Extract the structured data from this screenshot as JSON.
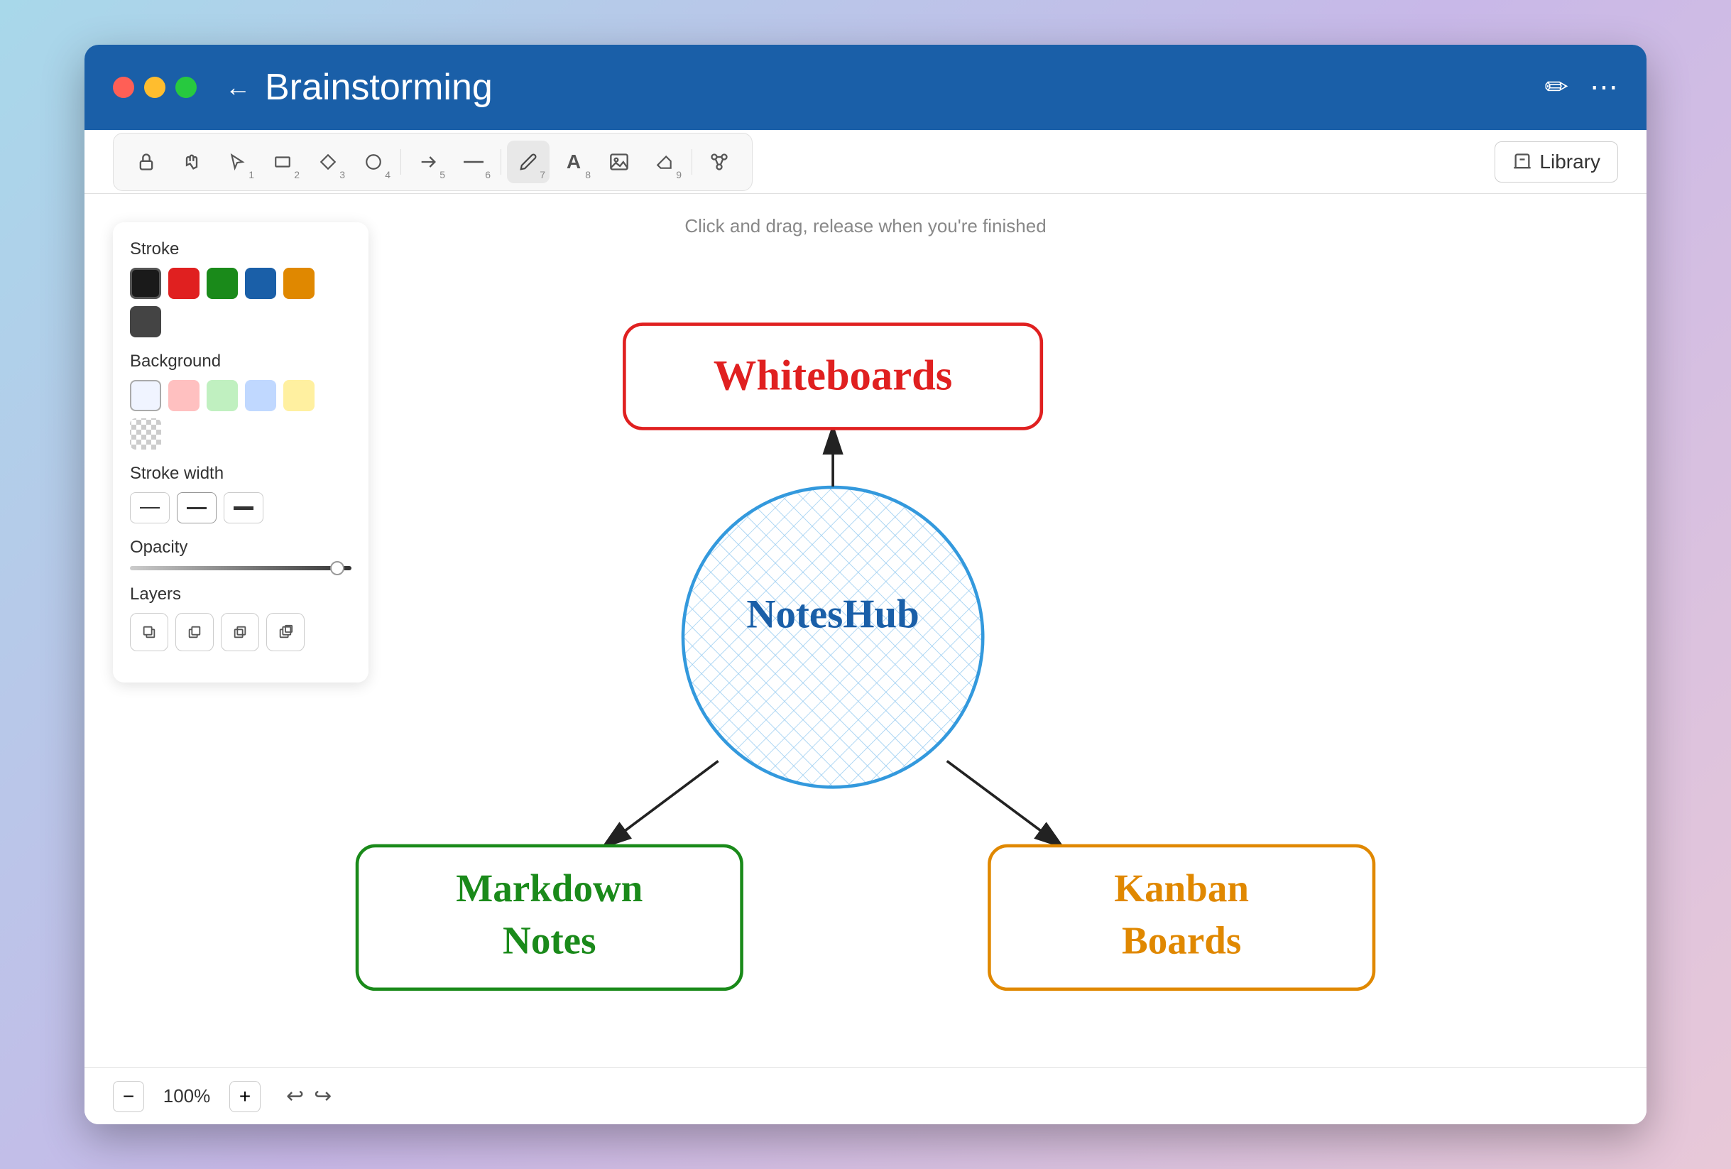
{
  "window": {
    "title": "Brainstorming",
    "back_label": "←",
    "edit_icon": "✏️",
    "more_icon": "⋯"
  },
  "toolbar": {
    "tools": [
      {
        "id": "lock",
        "icon": "🔒",
        "num": "",
        "active": false
      },
      {
        "id": "hand",
        "icon": "✋",
        "num": "",
        "active": false
      },
      {
        "id": "select",
        "icon": "↗",
        "num": "1",
        "active": false
      },
      {
        "id": "rectangle",
        "icon": "□",
        "num": "2",
        "active": false
      },
      {
        "id": "diamond",
        "icon": "◇",
        "num": "3",
        "active": false
      },
      {
        "id": "circle",
        "icon": "○",
        "num": "4",
        "active": false
      },
      {
        "id": "arrow",
        "icon": "→",
        "num": "5",
        "active": false
      },
      {
        "id": "line",
        "icon": "—",
        "num": "6",
        "active": false
      },
      {
        "id": "pen",
        "icon": "✏",
        "num": "7",
        "active": true
      },
      {
        "id": "text",
        "icon": "A",
        "num": "8",
        "active": false
      },
      {
        "id": "image",
        "icon": "🖼",
        "num": "",
        "active": false
      },
      {
        "id": "eraser",
        "icon": "◻",
        "num": "9",
        "active": false
      },
      {
        "id": "connect",
        "icon": "⬡",
        "num": "",
        "active": false
      }
    ],
    "library_label": "Library"
  },
  "hint": "Click and drag, release when you're finished",
  "left_panel": {
    "stroke_label": "Stroke",
    "stroke_colors": [
      {
        "color": "#1a1a1a",
        "selected": true
      },
      {
        "color": "#e02020",
        "selected": false
      },
      {
        "color": "#1a8a1a",
        "selected": false
      },
      {
        "color": "#1a5fa8",
        "selected": false
      },
      {
        "color": "#e08800",
        "selected": false
      },
      {
        "color": "#444444",
        "selected": false
      }
    ],
    "background_label": "Background",
    "bg_colors": [
      {
        "color": "#f0f4ff",
        "selected": true
      },
      {
        "color": "#ffc0c0",
        "selected": false
      },
      {
        "color": "#c0f0c0",
        "selected": false
      },
      {
        "color": "#c0d8ff",
        "selected": false
      },
      {
        "color": "#fff0a0",
        "selected": false
      },
      {
        "color": "transparent",
        "selected": false
      }
    ],
    "stroke_width_label": "Stroke width",
    "opacity_label": "Opacity",
    "layers_label": "Layers"
  },
  "diagram": {
    "center_label": "NotesHub",
    "top_label": "Whiteboards",
    "left_label": "Markdown\nNotes",
    "right_label": "Kanban\nBoards"
  },
  "bottom_bar": {
    "zoom": "100%",
    "zoom_in": "+",
    "zoom_out": "−",
    "undo": "↩",
    "redo": "↪"
  }
}
